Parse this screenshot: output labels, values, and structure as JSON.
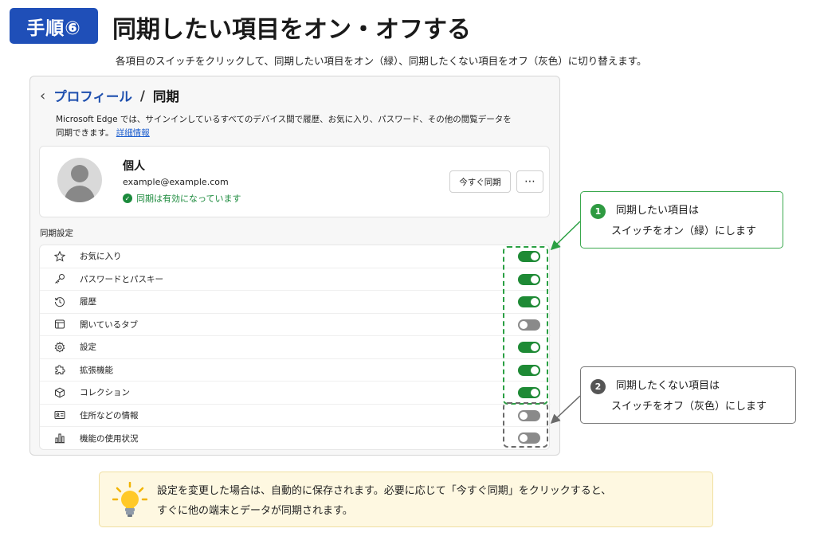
{
  "header": {
    "step_badge": "手順⑥",
    "title": "同期したい項目をオン・オフする",
    "description": "各項目のスイッチをクリックして、同期したい項目をオン（緑）、同期したくない項目をオフ（灰色）に切り替えます。"
  },
  "window": {
    "breadcrumb_parent": "プロフィール",
    "breadcrumb_separator": "/",
    "breadcrumb_current": "同期",
    "intro_line1": "Microsoft Edge では、サインインしているすべてのデバイス間で履歴、お気に入り、パスワード、その他の閲覧データを",
    "intro_line2": "同期できます。",
    "intro_link": "詳細情報"
  },
  "profile": {
    "name": "個人",
    "email": "example@example.com",
    "status": "同期は有効になっています",
    "sync_now_label": "今すぐ同期",
    "more_label": "⋯"
  },
  "sync": {
    "section_label": "同期設定",
    "items": [
      {
        "label": "お気に入り",
        "icon": "star-icon",
        "on": true
      },
      {
        "label": "パスワードとパスキー",
        "icon": "key-icon",
        "on": true
      },
      {
        "label": "履歴",
        "icon": "history-icon",
        "on": true
      },
      {
        "label": "開いているタブ",
        "icon": "tabs-icon",
        "on": false
      },
      {
        "label": "設定",
        "icon": "gear-icon",
        "on": true
      },
      {
        "label": "拡張機能",
        "icon": "puzzle-icon",
        "on": true
      },
      {
        "label": "コレクション",
        "icon": "box-icon",
        "on": true
      },
      {
        "label": "住所などの情報",
        "icon": "id-card-icon",
        "on": false
      },
      {
        "label": "機能の使用状況",
        "icon": "bar-chart-icon",
        "on": false
      }
    ]
  },
  "callouts": {
    "on": {
      "number": "1",
      "line1": "同期したい項目は",
      "line2": "スイッチをオン（緑）にします"
    },
    "off": {
      "number": "2",
      "line1": "同期したくない項目は",
      "line2": "スイッチをオフ（灰色）にします"
    }
  },
  "tip": {
    "line1": "設定を変更した場合は、自動的に保存されます。必要に応じて「今すぐ同期」をクリックすると、",
    "line2": "すぐに他の端末とデータが同期されます。"
  },
  "colors": {
    "badge": "#1f4fb8",
    "toggle_on": "#1e8a35",
    "toggle_off": "#8a8a8a",
    "link": "#1e4fae",
    "tip_bg": "#fef8e1"
  }
}
